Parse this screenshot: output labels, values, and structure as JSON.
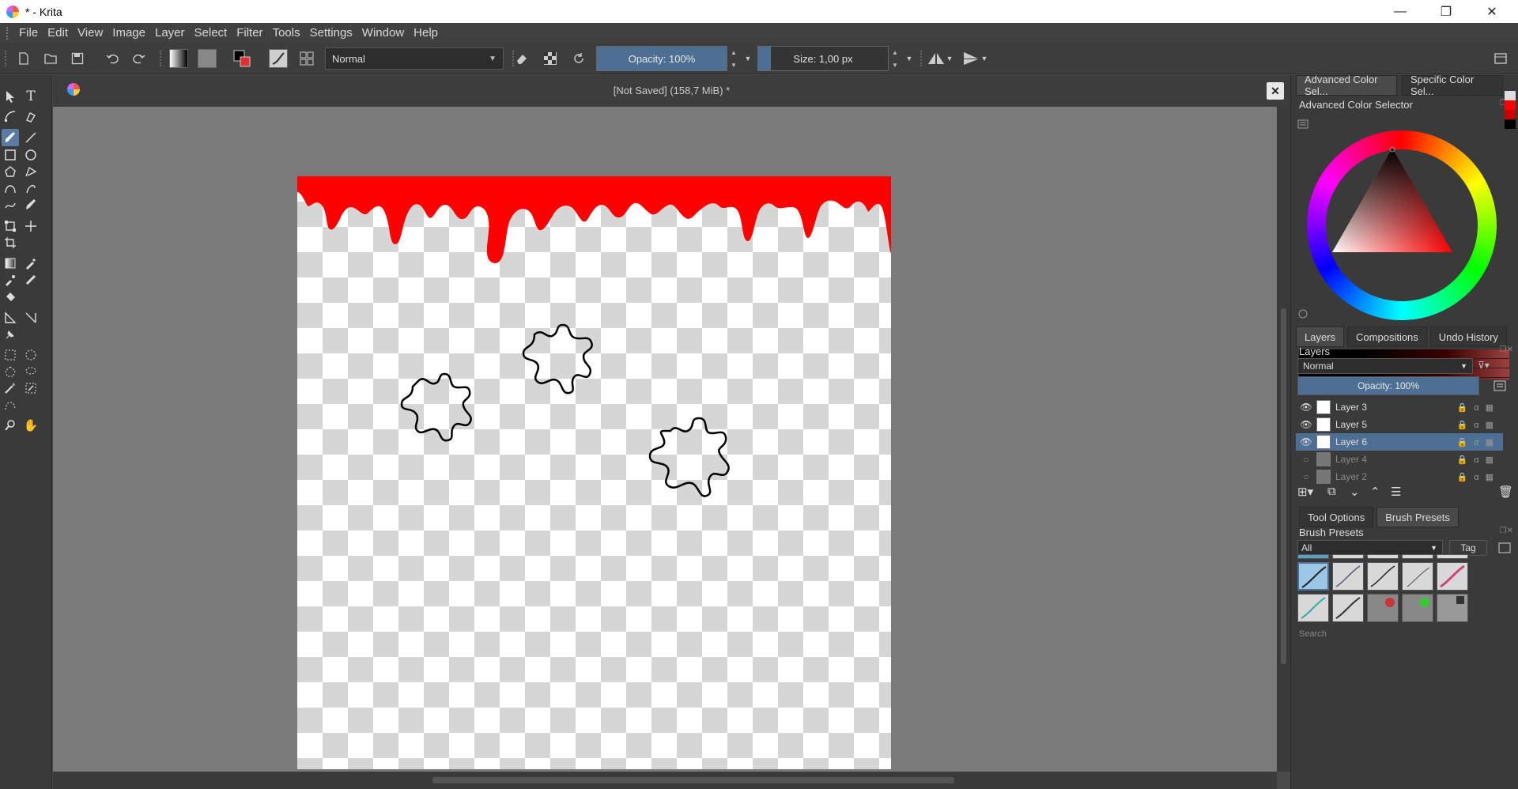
{
  "window": {
    "title": "* - Krita",
    "controls": {
      "minimize": "—",
      "maximize": "❐",
      "close": "✕"
    }
  },
  "menu": [
    "File",
    "Edit",
    "View",
    "Image",
    "Layer",
    "Select",
    "Filter",
    "Tools",
    "Settings",
    "Window",
    "Help"
  ],
  "toolbar": {
    "blend_mode": "Normal",
    "opacity": "Opacity: 100%",
    "size": "Size: 1,00 px"
  },
  "document": {
    "title": "[Not Saved]  (158,7 MiB) *",
    "close": "✕"
  },
  "canvas": {
    "drip_color": "#ff0000",
    "splat_color": "#000000"
  },
  "color_panel": {
    "tabs": [
      "Advanced Color Sel...",
      "Specific Color Sel..."
    ],
    "title": "Advanced Color Selector"
  },
  "layers_panel": {
    "tabs": [
      "Layers",
      "Compositions",
      "Undo History"
    ],
    "title": "Layers",
    "blend_mode": "Normal",
    "opacity": "Opacity:  100%",
    "layers": [
      {
        "name": "Layer 3",
        "visible": true,
        "selected": false
      },
      {
        "name": "Layer 5",
        "visible": true,
        "selected": false
      },
      {
        "name": "Layer 6",
        "visible": true,
        "selected": true
      },
      {
        "name": "Layer 4",
        "visible": false,
        "selected": false
      },
      {
        "name": "Layer 2",
        "visible": false,
        "selected": false
      }
    ]
  },
  "brush_panel": {
    "tabs": [
      "Tool Options",
      "Brush Presets"
    ],
    "title": "Brush Presets",
    "filter": "All",
    "tag": "Tag",
    "search_placeholder": "Search"
  }
}
